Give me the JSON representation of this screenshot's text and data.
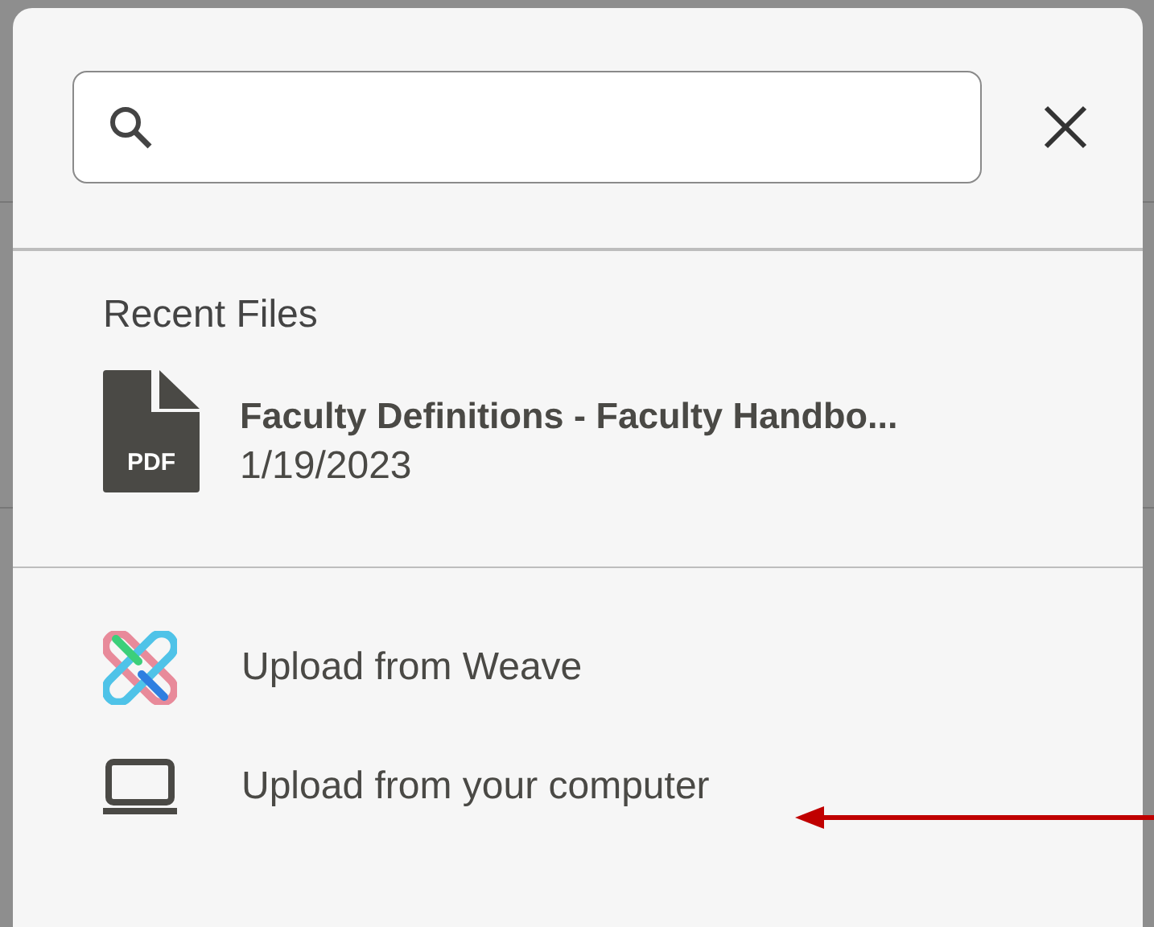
{
  "recent_files": {
    "heading": "Recent Files",
    "items": [
      {
        "name": "Faculty Definitions - Faculty Handbo...",
        "date": "1/19/2023",
        "type_label": "PDF"
      }
    ]
  },
  "upload_options": [
    {
      "kind": "weave",
      "label": "Upload from Weave"
    },
    {
      "kind": "computer",
      "label": "Upload from your computer"
    }
  ]
}
